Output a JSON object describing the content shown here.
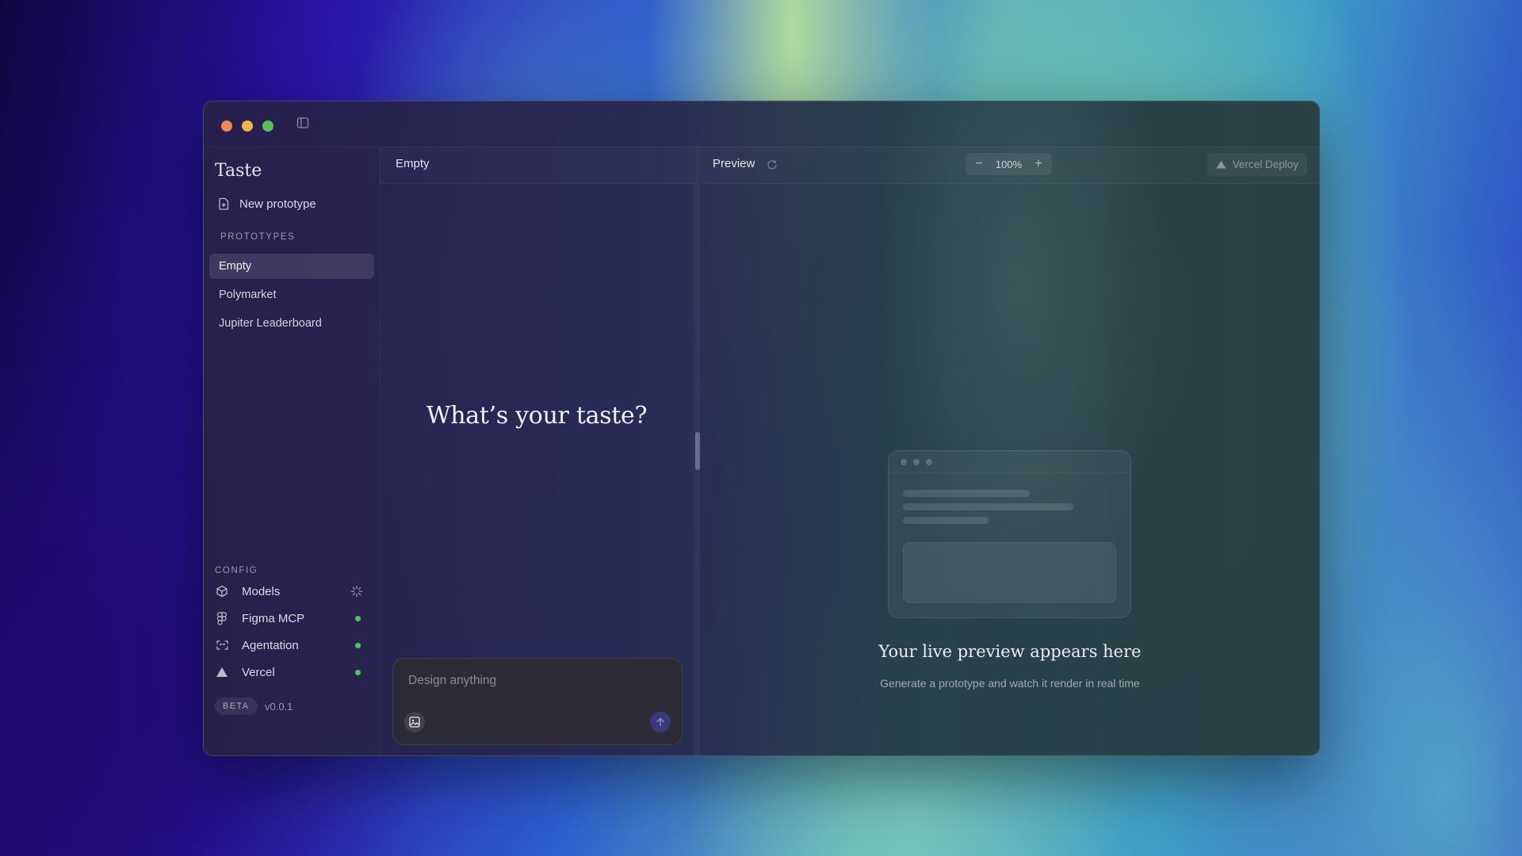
{
  "app": {
    "title": "Taste"
  },
  "sidebar": {
    "new_prototype_label": "New prototype",
    "prototypes_heading": "PROTOTYPES",
    "prototypes": [
      {
        "label": "Empty",
        "active": true
      },
      {
        "label": "Polymarket",
        "active": false
      },
      {
        "label": "Jupiter Leaderboard",
        "active": false
      }
    ],
    "config_heading": "CONFIG",
    "config_items": [
      {
        "label": "Models",
        "icon": "cube-icon",
        "status": "loading"
      },
      {
        "label": "Figma MCP",
        "icon": "figma-icon",
        "status": "connected"
      },
      {
        "label": "Agentation",
        "icon": "agentation-icon",
        "status": "connected"
      },
      {
        "label": "Vercel",
        "icon": "vercel-triangle-icon",
        "status": "connected"
      }
    ],
    "beta_badge": "BETA",
    "version": "v0.0.1"
  },
  "chat": {
    "title": "Empty",
    "hero": "What’s your taste?",
    "input": {
      "value": "",
      "placeholder": "Design anything"
    }
  },
  "preview": {
    "title": "Preview",
    "zoom": {
      "minus": "−",
      "level": "100%",
      "plus": "+"
    },
    "deploy_label": "Vercel Deploy",
    "empty_heading": "Your live preview appears here",
    "empty_subtext": "Generate a prototype and watch it render in real time"
  },
  "colors": {
    "status_connected": "#4fc35c",
    "traffic_red": "#f0865a",
    "traffic_yellow": "#f1b44a",
    "traffic_green": "#58c258"
  }
}
